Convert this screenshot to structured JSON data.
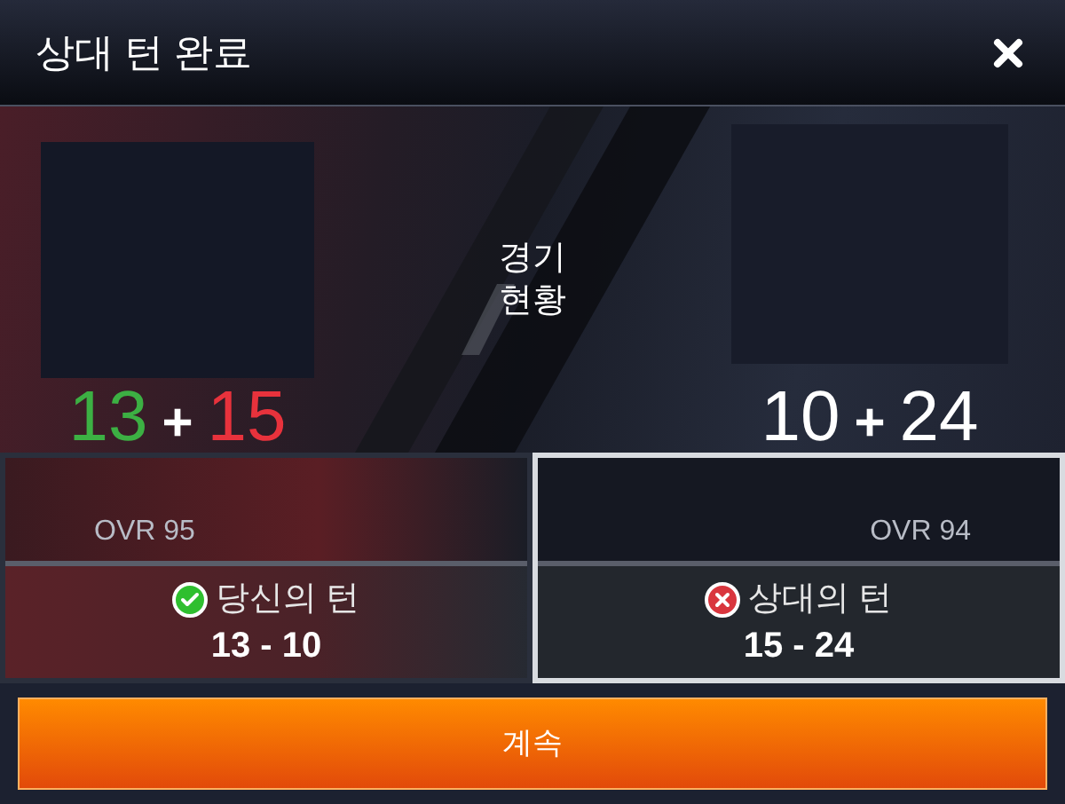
{
  "title": "상대 턴 완료",
  "center_label": "경기\n현황",
  "players": [
    {
      "score": [
        {
          "text": "13",
          "color": "#3cb043"
        },
        {
          "text": "+",
          "color": "#ffffff"
        },
        {
          "text": "15",
          "color": "#e8323c"
        }
      ],
      "ovr": "OVR 95",
      "won": true,
      "turn_label": "당신의 턴",
      "turn_score": "13 - 10",
      "selected": false
    },
    {
      "score": [
        {
          "text": "10",
          "color": "#ffffff"
        },
        {
          "text": "+",
          "color": "#ffffff"
        },
        {
          "text": "24",
          "color": "#ffffff"
        }
      ],
      "ovr": "OVR 94",
      "won": false,
      "turn_label": "상대의 턴",
      "turn_score": "15 - 24",
      "selected": true
    }
  ],
  "continue_button": "계속"
}
